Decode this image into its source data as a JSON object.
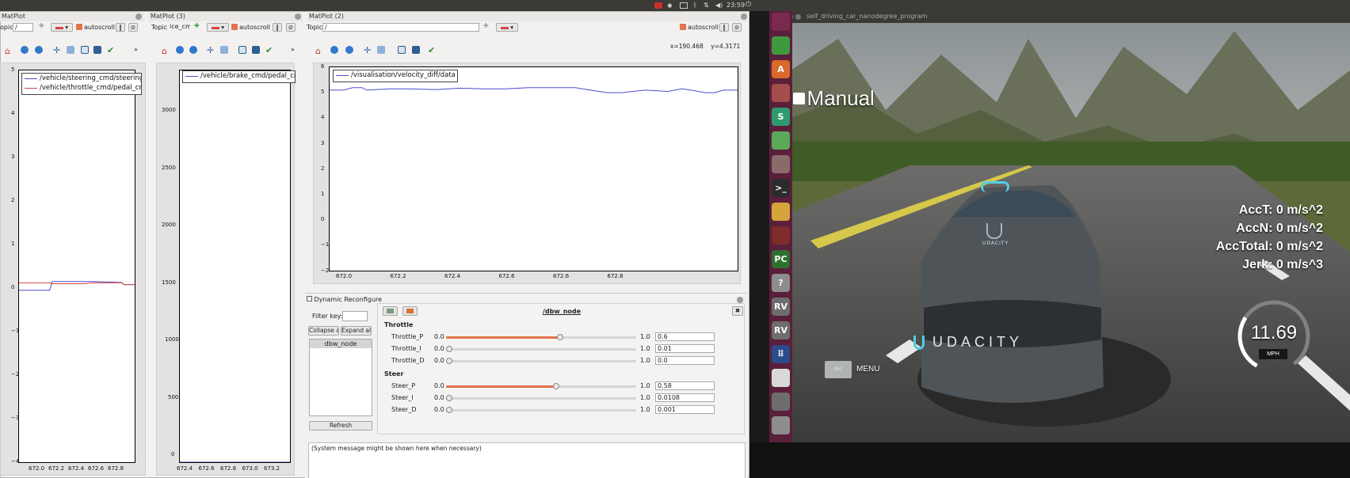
{
  "system": {
    "time": "23:59"
  },
  "windows": {
    "mp1": {
      "title": "MatPlot"
    },
    "mp3": {
      "title": "MatPlot (3)"
    },
    "mp2": {
      "title": "MatPlot (2)"
    },
    "sim": {
      "title": "self_driving_car_nanodegree_program"
    }
  },
  "toolbar": {
    "topic_label_short": "opic",
    "topic_label": "Topic",
    "topic_value": "/",
    "topic_value_3": "ice_cmd",
    "autoscroll": "autoscroll",
    "more": "»",
    "coords": "x=190.468    y=4.3171"
  },
  "plot1": {
    "legend": [
      "/vehicle/steering_cmd/steering_wheel_angle_cmd",
      "/vehicle/throttle_cmd/pedal_cmd"
    ],
    "yticks": [
      "5",
      "4",
      "3",
      "2",
      "1",
      "0",
      "−1",
      "−2",
      "−3",
      "−4"
    ],
    "xticks": [
      "672.0",
      "672.2",
      "672.4",
      "672.6",
      "672.8"
    ]
  },
  "plot3": {
    "legend": [
      "/vehicle/brake_cmd/pedal_cmd"
    ],
    "yticks": [
      "3000",
      "2500",
      "2000",
      "1500",
      "1000",
      "500",
      "0"
    ],
    "xticks": [
      "672.4",
      "672.6",
      "672.8",
      "673.0",
      "673.2"
    ]
  },
  "plot2": {
    "legend": [
      "/visualisation/velocity_diff/data"
    ],
    "yticks": [
      "6",
      "5",
      "4",
      "3",
      "2",
      "1",
      "0",
      "−1",
      "−2"
    ],
    "xticks": [
      "672.0",
      "672.2",
      "672.4",
      "672.6",
      "672.6",
      "672.8"
    ]
  },
  "chart_data": [
    {
      "type": "line",
      "xlim": [
        671.95,
        672.82
      ],
      "ylim": [
        -4,
        5
      ],
      "series": [
        {
          "name": "/vehicle/steering_cmd/steering_wheel_angle_cmd",
          "color": "#4b4bd1",
          "x": [
            671.95,
            672.18,
            672.2,
            672.5,
            672.72,
            672.74,
            672.82
          ],
          "y": [
            -0.05,
            -0.05,
            0.15,
            0.15,
            0.13,
            0.08,
            0.08
          ]
        },
        {
          "name": "/vehicle/throttle_cmd/pedal_cmd",
          "color": "#d64545",
          "x": [
            671.95,
            672.18,
            672.2,
            672.45,
            672.5,
            672.72,
            672.74,
            672.82
          ],
          "y": [
            0.12,
            0.12,
            0.1,
            0.1,
            0.12,
            0.12,
            0.08,
            0.08
          ]
        }
      ]
    },
    {
      "type": "line",
      "xlim": [
        672.33,
        673.37
      ],
      "ylim": [
        0,
        3200
      ],
      "series": [
        {
          "name": "/vehicle/brake_cmd/pedal_cmd",
          "color": "#4b4bd1",
          "x": [
            672.33,
            673.37
          ],
          "y": [
            0,
            0
          ]
        }
      ]
    },
    {
      "type": "line",
      "xlim": [
        671.97,
        672.85
      ],
      "ylim": [
        -2,
        6
      ],
      "series": [
        {
          "name": "/visualisation/velocity_diff/data",
          "color": "#4b4bd1",
          "x": [
            671.97,
            672.0,
            672.02,
            672.04,
            672.05,
            672.1,
            672.14,
            672.2,
            672.25,
            672.3,
            672.35,
            672.4,
            672.45,
            672.5,
            672.55,
            672.57,
            672.6,
            672.65,
            672.7,
            672.73,
            672.75,
            672.78,
            672.8,
            672.82,
            672.85
          ],
          "y": [
            5.1,
            5.1,
            5.2,
            5.2,
            5.1,
            5.15,
            5.15,
            5.12,
            5.18,
            5.15,
            5.15,
            5.2,
            5.2,
            5.2,
            5.05,
            5.0,
            5.0,
            5.1,
            5.05,
            5.15,
            5.1,
            5.0,
            5.0,
            5.1,
            5.1
          ]
        }
      ]
    }
  ],
  "reconfigure": {
    "title": "Dynamic Reconfigure",
    "filter_label": "Filter key:",
    "collapse": "Collapse all",
    "expand": "Expand all",
    "node": "dbw_node",
    "refresh": "Refresh",
    "node_title": "/dbw_node",
    "message": "(System message might be shown here when necessary)",
    "groups": [
      {
        "name": "Throttle",
        "params": [
          {
            "label": "Throttle_P",
            "min": "0.0",
            "max": "1.0",
            "value": "0.6",
            "frac": 0.6
          },
          {
            "label": "Throttle_I",
            "min": "0.0",
            "max": "1.0",
            "value": "0.01",
            "frac": 0.01
          },
          {
            "label": "Throttle_D",
            "min": "0.0",
            "max": "1.0",
            "value": "0.0",
            "frac": 0.0
          }
        ]
      },
      {
        "name": "Steer",
        "params": [
          {
            "label": "Steer_P",
            "min": "0.0",
            "max": "1.0",
            "value": "0.58",
            "frac": 0.58
          },
          {
            "label": "Steer_I",
            "min": "0.0",
            "max": "1.0",
            "value": "0.0108",
            "frac": 0.0108
          },
          {
            "label": "Steer_D",
            "min": "0.0",
            "max": "1.0",
            "value": "0.001",
            "frac": 0.001
          }
        ]
      }
    ]
  },
  "simulator": {
    "manual": "Manual",
    "acc_t": "AccT: 0 m/s^2",
    "acc_n": "AccN: 0 m/s^2",
    "acc_total": "AccTotal: 0 m/s^2",
    "jerk": "Jerk: 0 m/s^3",
    "speed": 11.69,
    "speed_text": "11.69",
    "unit": "MPH",
    "esc": "ESC",
    "menu": "MENU",
    "brand_car": "UDACITY",
    "brand_rear": "UDACITY"
  },
  "launcher": [
    "ubuntu-icon",
    "spreadsheet-icon",
    "font-viewer-icon",
    "settings-icon",
    "slack-icon",
    "browser-icon",
    "files-icon",
    "terminal-icon",
    "chrome-icon",
    "media-icon",
    "pycharm-icon",
    "help-icon",
    "rviz-icon",
    "rviz-icon",
    "apps-grid-icon",
    "text-editor-icon",
    "drive-icon",
    "trash-icon"
  ],
  "colors": {
    "accent": "#e2734b",
    "launcher": "#5a1f3a",
    "series_blue": "#4b4bd1",
    "series_red": "#d64545"
  }
}
